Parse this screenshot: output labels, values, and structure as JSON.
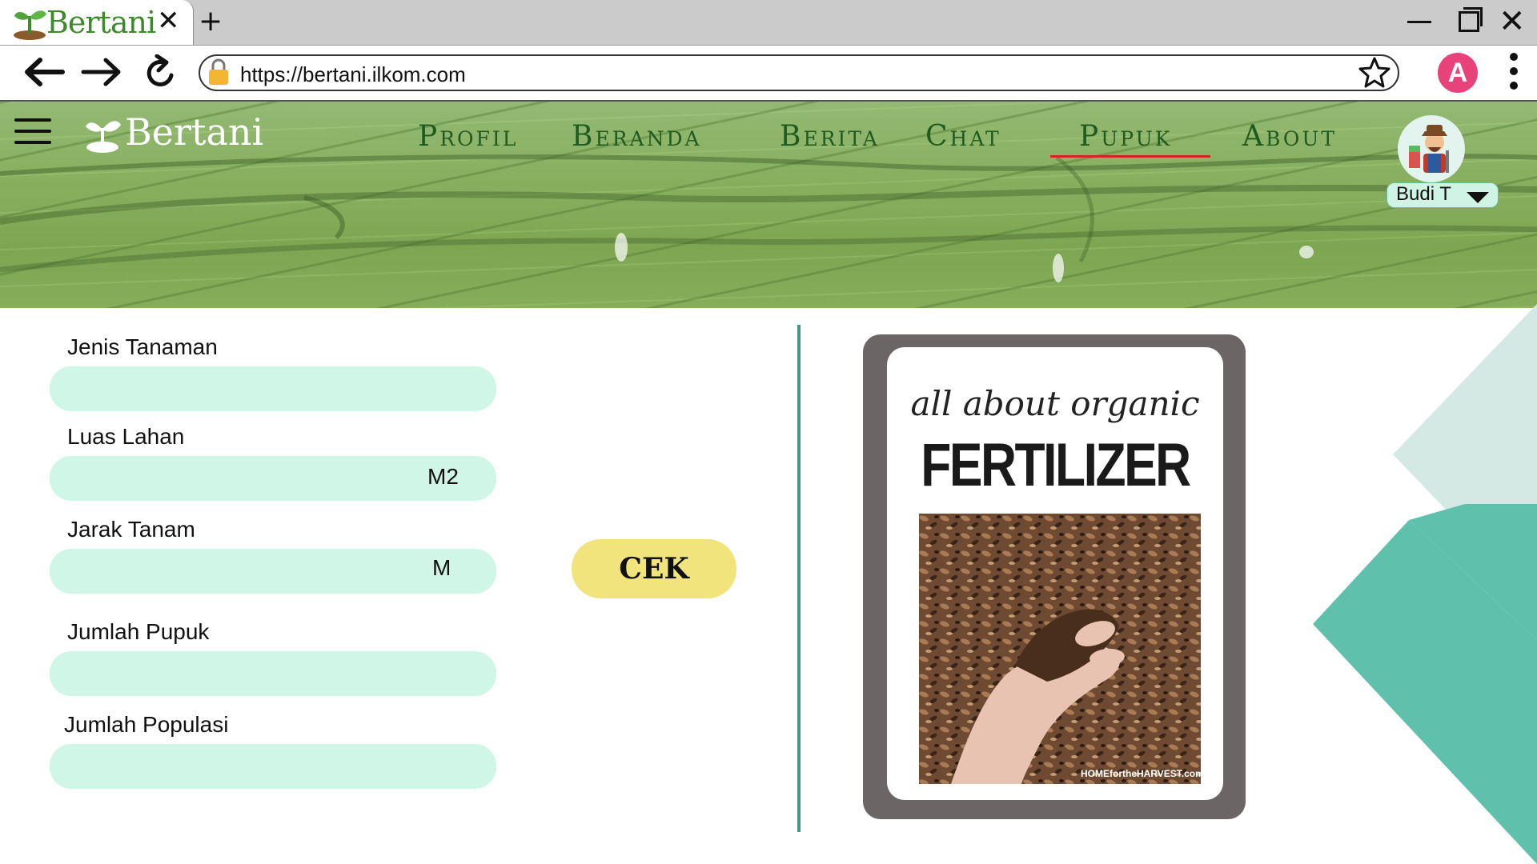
{
  "browser": {
    "tab_title": "Bertani",
    "url": "https://bertani.ilkom.com"
  },
  "header": {
    "logo": "Bertani",
    "nav": [
      "Profil",
      "Beranda",
      "Berita",
      "Chat",
      "Pupuk",
      "About"
    ],
    "active_nav": "Pupuk",
    "user_name": "Budi T"
  },
  "form": {
    "jenis_tanaman": {
      "label": "Jenis Tanaman",
      "value": ""
    },
    "luas_lahan": {
      "label": "Luas Lahan",
      "value": "",
      "unit": "M2"
    },
    "jarak_tanam": {
      "label": "Jarak Tanam",
      "value": "",
      "unit": "M"
    },
    "jumlah_pupuk": {
      "label": "Jumlah Pupuk",
      "value": ""
    },
    "jumlah_populasi": {
      "label": "Jumlah Populasi",
      "value": ""
    },
    "button": "CEK"
  },
  "poster": {
    "script": "all about organic",
    "title": "FERTILIZER",
    "credit": "HOMEfortheHARVEST.com"
  },
  "colors": {
    "field_bg": "#cff6e6",
    "button_bg": "#f2e47d",
    "accent_teal": "#3d9b85",
    "active_underline": "#d0242a",
    "nav_text": "#1f5a1e"
  }
}
